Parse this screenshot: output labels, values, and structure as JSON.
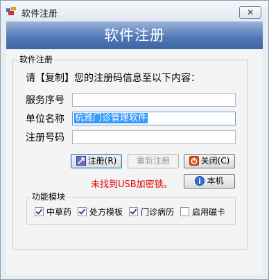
{
  "window": {
    "title": "软件注册",
    "close_label": "✕"
  },
  "banner": {
    "title": "软件注册"
  },
  "group": {
    "title": "软件注册",
    "prompt": "请【复制】您的注册码信息至以下内容："
  },
  "fields": [
    {
      "label": "服务序号",
      "value": ""
    },
    {
      "label": "单位名称",
      "value": "杭雅门诊管理软件"
    },
    {
      "label": "注册号码",
      "value": ""
    }
  ],
  "buttons": {
    "register": "注册(R)",
    "reregister": "重新注册",
    "close": "关闭(C)",
    "local": "本机"
  },
  "status": {
    "error": "未找到USB加密锁。"
  },
  "modules": {
    "title": "功能模块",
    "items": [
      {
        "label": "中草药",
        "checked": true
      },
      {
        "label": "处方模板",
        "checked": true
      },
      {
        "label": "门诊病历",
        "checked": true
      },
      {
        "label": "启用磁卡",
        "checked": false
      }
    ]
  }
}
